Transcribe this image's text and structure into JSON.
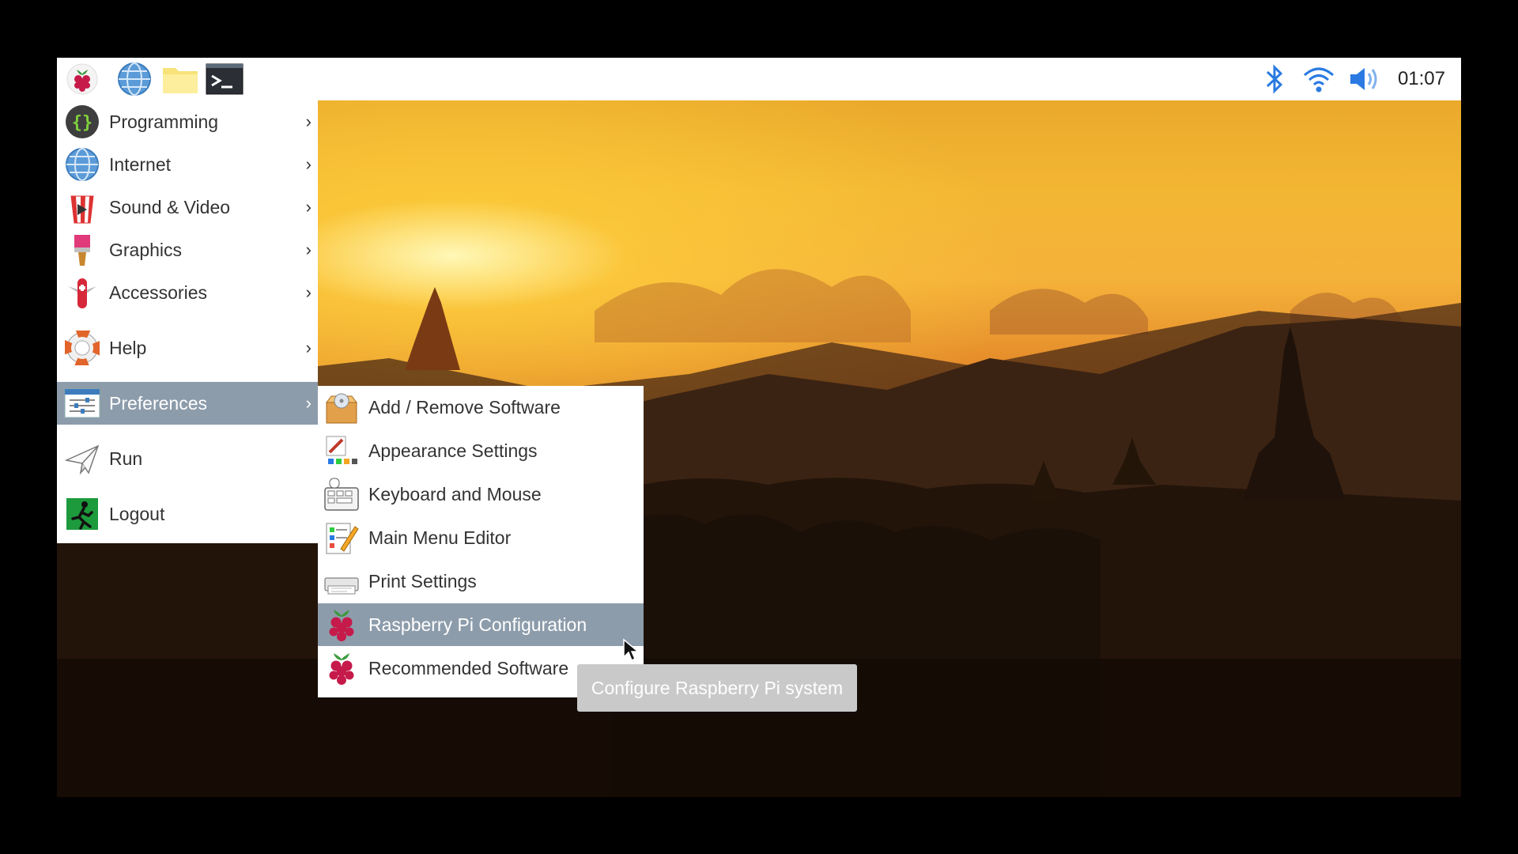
{
  "taskbar": {
    "launchers": [
      {
        "name": "raspberry-menu-icon"
      },
      {
        "name": "web-browser-icon"
      },
      {
        "name": "file-manager-icon"
      },
      {
        "name": "terminal-icon"
      }
    ],
    "tray": {
      "bluetooth_icon": "bluetooth-icon",
      "wifi_icon": "wifi-icon",
      "volume_icon": "volume-icon"
    },
    "clock": "01:07"
  },
  "main_menu": {
    "items": [
      {
        "label": "Programming",
        "icon": "programming-icon",
        "has_submenu": true
      },
      {
        "label": "Internet",
        "icon": "globe-icon",
        "has_submenu": true
      },
      {
        "label": "Sound & Video",
        "icon": "popcorn-icon",
        "has_submenu": true
      },
      {
        "label": "Graphics",
        "icon": "paintbrush-icon",
        "has_submenu": true
      },
      {
        "label": "Accessories",
        "icon": "pocketknife-icon",
        "has_submenu": true
      },
      {
        "label": "Help",
        "icon": "lifebuoy-icon",
        "has_submenu": true
      },
      {
        "label": "Preferences",
        "icon": "preferences-icon",
        "has_submenu": true,
        "active": true
      },
      {
        "label": "Run",
        "icon": "paper-plane-icon",
        "has_submenu": false
      },
      {
        "label": "Logout",
        "icon": "exit-icon",
        "has_submenu": false
      }
    ],
    "arrow": "›"
  },
  "preferences_submenu": {
    "items": [
      {
        "label": "Add / Remove Software",
        "icon": "software-box-icon"
      },
      {
        "label": "Appearance Settings",
        "icon": "appearance-icon"
      },
      {
        "label": "Keyboard and Mouse",
        "icon": "keyboard-mouse-icon"
      },
      {
        "label": "Main Menu Editor",
        "icon": "menu-editor-icon"
      },
      {
        "label": "Print Settings",
        "icon": "printer-icon"
      },
      {
        "label": "Raspberry Pi Configuration",
        "icon": "raspberry-icon",
        "active": true
      },
      {
        "label": "Recommended Software",
        "icon": "raspberry-icon"
      }
    ]
  },
  "tooltip": "Configure Raspberry Pi system",
  "colors": {
    "menu_highlight": "#8d9cab",
    "menu_bg": "#ffffff",
    "tooltip_bg": "#c9c9c9"
  }
}
